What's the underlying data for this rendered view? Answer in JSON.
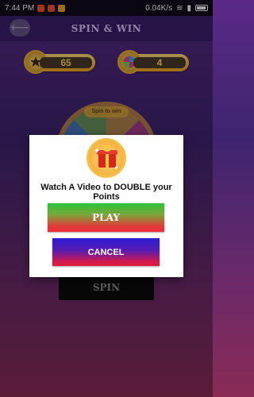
{
  "status_bar": {
    "time": "7:44 PM",
    "speed": "0.04K/s"
  },
  "app_bar": {
    "title": "SPIN & WIN",
    "back_icon": "back-arrow-icon"
  },
  "stats": {
    "stars": "65",
    "spins": "4"
  },
  "wheel": {
    "label": "Spin to win"
  },
  "spin_button": "SPIN",
  "dialog": {
    "message": "Watch A Video to DOUBLE your Points",
    "play_label": "PLAY",
    "cancel_label": "CANCEL",
    "icon": "gift-icon"
  },
  "colors": {
    "accent_gold": "#f3a519",
    "background": "#3e2470",
    "play_green": "#2bc33a",
    "play_red": "#f22b3a",
    "cancel_blue": "#2b1ad6",
    "cancel_red": "#e01a3a"
  }
}
